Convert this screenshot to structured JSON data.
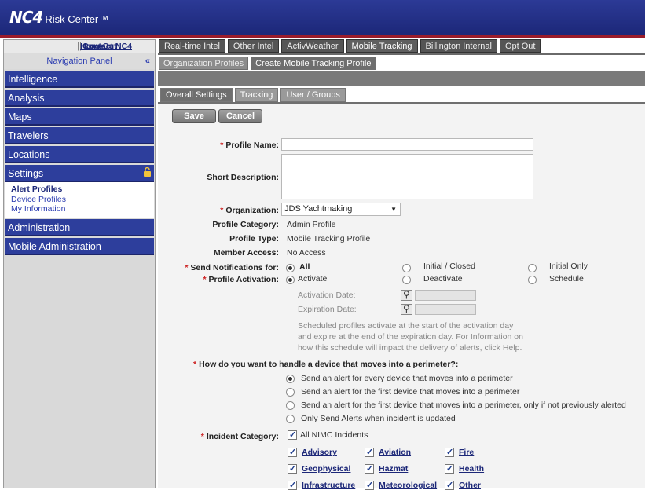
{
  "header": {
    "logo_text": "NC4",
    "logo_suffix": "Risk Center™"
  },
  "topbar": {
    "home": "Home",
    "contact": "Contact NC4",
    "logout": "Log-Out",
    "sep": "|"
  },
  "nav": {
    "panel_title": "Navigation Panel",
    "collapse_glyph": "«",
    "items": [
      "Intelligence",
      "Analysis",
      "Maps",
      "Travelers",
      "Locations",
      "Settings"
    ],
    "settings_sub": [
      "Alert Profiles",
      "Device Profiles",
      "My Information"
    ],
    "bottom_items": [
      "Administration",
      "Mobile Administration"
    ]
  },
  "tabs_main": [
    "Real-time Intel",
    "Other Intel",
    "ActivWeather",
    "Mobile Tracking",
    "Billington Internal",
    "Opt Out"
  ],
  "tabs_sub": [
    "Organization Profiles",
    "Create Mobile Tracking Profile"
  ],
  "tabs_form": [
    "Overall Settings",
    "Tracking",
    "User / Groups"
  ],
  "buttons": {
    "save": "Save",
    "cancel": "Cancel"
  },
  "form": {
    "profile_name_label": "Profile Name:",
    "short_desc_label": "Short Description:",
    "org_label": "Organization:",
    "org_value": "JDS Yachtmaking",
    "category_label": "Profile Category:",
    "category_value": "Admin Profile",
    "type_label": "Profile Type:",
    "type_value": "Mobile Tracking Profile",
    "member_label": "Member Access:",
    "member_value": "No Access",
    "send_label": "Send Notifications for:",
    "send_options": [
      "All",
      "Initial / Closed",
      "Initial Only"
    ],
    "activation_label": "Profile Activation:",
    "activation_options": [
      "Activate",
      "Deactivate",
      "Schedule"
    ],
    "activation_date_label": "Activation Date:",
    "expiration_date_label": "Expiration Date:",
    "schedule_note_1": "Scheduled profiles activate at the start of the activation day",
    "schedule_note_2": "and expire at the end of the expiration day. For Information on",
    "schedule_note_3": "how this schedule will impact the delivery of alerts, click Help.",
    "perimeter_question": "How do you want to handle a device that moves into a perimeter?:",
    "perimeter_options": [
      "Send an alert for every device that moves into a perimeter",
      "Send an alert for the first device that moves into a perimeter",
      "Send an alert for the first device that moves into a perimeter, only if not previously alerted",
      "Only Send Alerts when incident is updated"
    ],
    "incident_label": "Incident Category:",
    "all_incidents": "All NIMC Incidents",
    "categories": [
      "Advisory",
      "Aviation",
      "Fire",
      "Geophysical",
      "Hazmat",
      "Health",
      "Infrastructure",
      "Meteorological",
      "Other"
    ]
  },
  "colors": {
    "nav_blue": "#2d3e9c",
    "header_blue": "#1c2778",
    "required_red": "#cc1f1f"
  }
}
